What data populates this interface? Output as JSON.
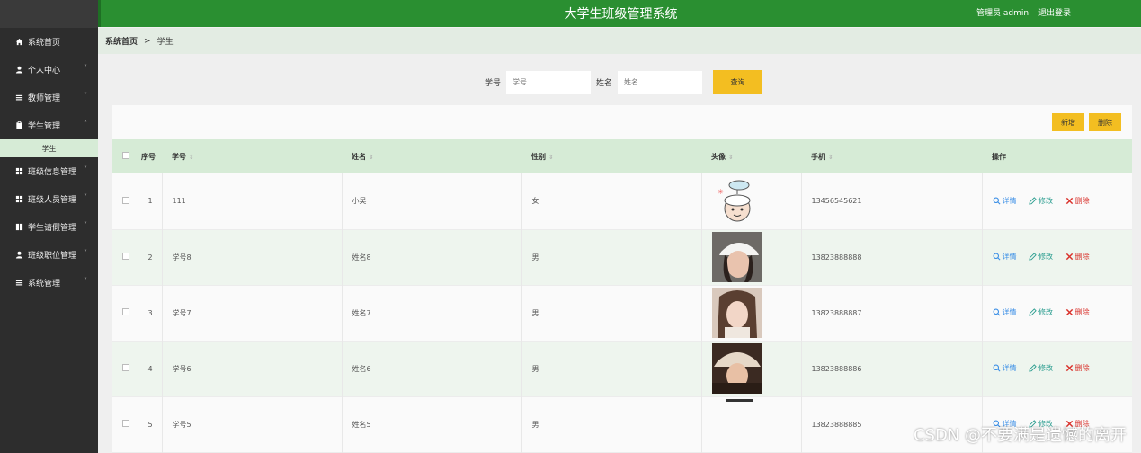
{
  "header": {
    "title": "大学生班级管理系统",
    "user": "管理员 admin",
    "logout": "退出登录"
  },
  "sidebar": {
    "items": [
      {
        "label": "系统首页",
        "icon": "home-icon"
      },
      {
        "label": "个人中心",
        "icon": "user-icon"
      },
      {
        "label": "教师管理",
        "icon": "list-icon"
      },
      {
        "label": "学生管理",
        "icon": "clipboard-icon"
      },
      {
        "label": "学生",
        "icon": ""
      },
      {
        "label": "班级信息管理",
        "icon": "grid-icon"
      },
      {
        "label": "班级人员管理",
        "icon": "grid-icon"
      },
      {
        "label": "学生请假管理",
        "icon": "grid-icon"
      },
      {
        "label": "班级职位管理",
        "icon": "user-icon"
      },
      {
        "label": "系统管理",
        "icon": "list-icon"
      }
    ]
  },
  "breadcrumb": {
    "home": "系统首页",
    "sep": ">",
    "current": "学生"
  },
  "search": {
    "label1": "学号",
    "placeholder1": "学号",
    "label2": "姓名",
    "placeholder2": "姓名",
    "button": "查询"
  },
  "toolbar": {
    "add": "新增",
    "delete": "删除"
  },
  "table": {
    "headers": {
      "index": "序号",
      "xuehao": "学号",
      "name": "姓名",
      "gender": "性别",
      "avatar": "头像",
      "phone": "手机",
      "ops": "操作"
    },
    "rows": [
      {
        "index": "1",
        "xuehao": "111",
        "name": "小吴",
        "gender": "女",
        "phone": "13456545621"
      },
      {
        "index": "2",
        "xuehao": "学号8",
        "name": "姓名8",
        "gender": "男",
        "phone": "13823888888"
      },
      {
        "index": "3",
        "xuehao": "学号7",
        "name": "姓名7",
        "gender": "男",
        "phone": "13823888887"
      },
      {
        "index": "4",
        "xuehao": "学号6",
        "name": "姓名6",
        "gender": "男",
        "phone": "13823888886"
      },
      {
        "index": "5",
        "xuehao": "学号5",
        "name": "姓名5",
        "gender": "男",
        "phone": "13823888885"
      }
    ],
    "ops": {
      "detail": "详情",
      "edit": "修改",
      "delete": "删除"
    }
  },
  "watermark": "CSDN @不要满是遗憾的离开",
  "colors": {
    "header": "#2a8f31",
    "sidebar": "#2d2d2d",
    "accent": "#f3be21",
    "tableHeader": "#d6ebd6"
  }
}
